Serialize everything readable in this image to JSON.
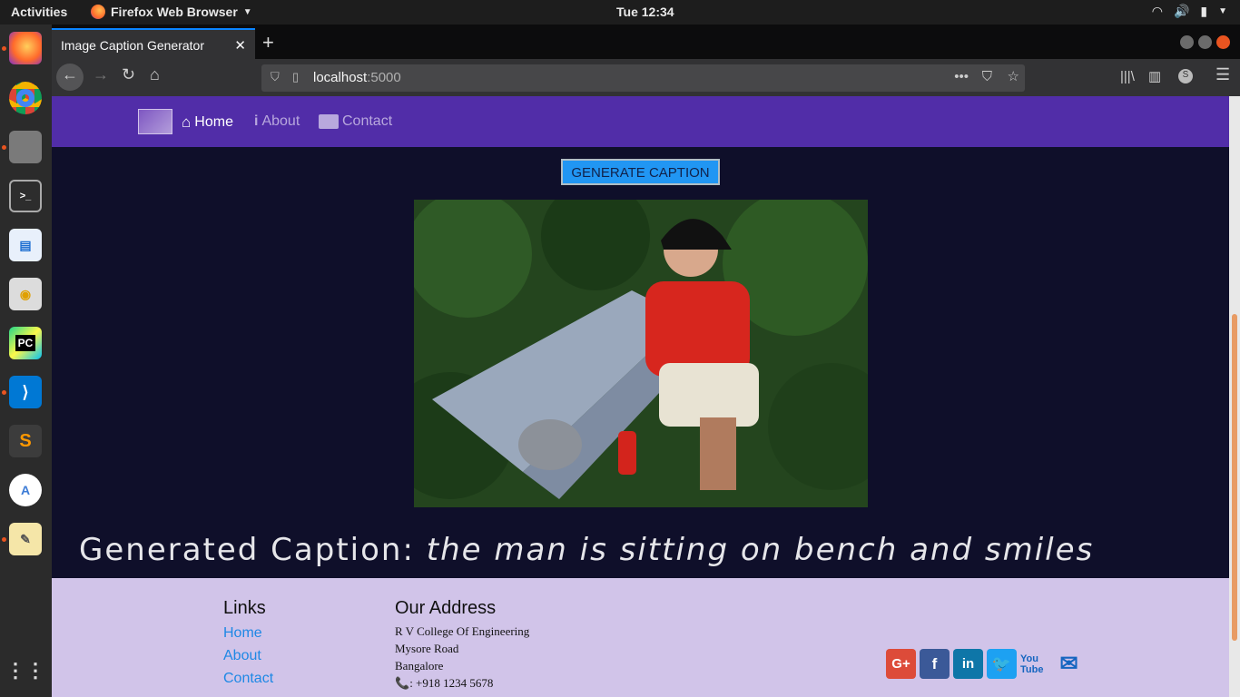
{
  "system": {
    "activities": "Activities",
    "app_name": "Firefox Web Browser",
    "clock": "Tue 12:34"
  },
  "browser": {
    "tab_title": "Image Caption Generator",
    "url_host": "localhost",
    "url_port": ":5000"
  },
  "site": {
    "nav": [
      {
        "label": "Home",
        "icon": "home-icon"
      },
      {
        "label": "About",
        "icon": "info-icon"
      },
      {
        "label": "Contact",
        "icon": "address-card-icon"
      }
    ],
    "generate_button": "GENERATE CAPTION",
    "caption_prefix": "Generated Caption:",
    "caption_text": "the man is sitting on bench and smiles"
  },
  "footer": {
    "links_title": "Links",
    "links": [
      "Home",
      "About",
      "Contact"
    ],
    "address_title": "Our Address",
    "address": [
      "R V College Of Engineering",
      "Mysore Road",
      "Bangalore"
    ],
    "phone": ": +918 1234 5678",
    "social": [
      "google-plus-icon",
      "facebook-icon",
      "linkedin-icon",
      "twitter-icon",
      "youtube-icon",
      "mail-icon"
    ]
  },
  "colors": {
    "nav_bg": "#512da8",
    "body_bg": "#0f0f2a",
    "footer_bg": "#d1c4e9",
    "button": "#2196f3",
    "link": "#1e88e5"
  }
}
